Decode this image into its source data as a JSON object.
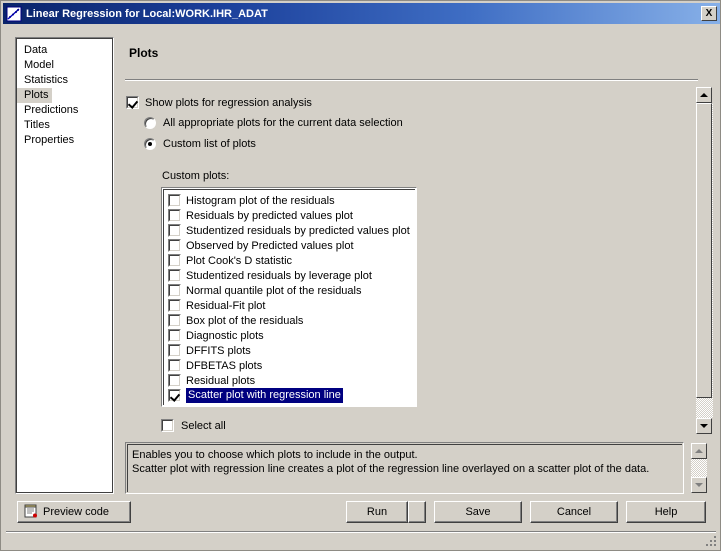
{
  "window": {
    "title": "Linear Regression for Local:WORK.IHR_ADAT",
    "title_icon": "regression-chart-icon",
    "close_label": "X"
  },
  "sidebar": {
    "items": [
      {
        "label": "Data",
        "selected": false
      },
      {
        "label": "Model",
        "selected": false
      },
      {
        "label": "Statistics",
        "selected": false
      },
      {
        "label": "Plots",
        "selected": true
      },
      {
        "label": "Predictions",
        "selected": false
      },
      {
        "label": "Titles",
        "selected": false
      },
      {
        "label": "Properties",
        "selected": false
      }
    ]
  },
  "main": {
    "page_title": "Plots",
    "show_plots": {
      "label": "Show plots for regression analysis",
      "checked": true
    },
    "plot_mode": {
      "options": [
        {
          "label": "All appropriate plots for the current data selection",
          "selected": false
        },
        {
          "label": "Custom list of plots",
          "selected": true
        }
      ]
    },
    "custom_plots_label": "Custom plots:",
    "custom_plots": [
      {
        "label": "Histogram plot of the residuals",
        "checked": false,
        "highlighted": false
      },
      {
        "label": "Residuals by predicted values plot",
        "checked": false,
        "highlighted": false
      },
      {
        "label": "Studentized residuals by predicted values plot",
        "checked": false,
        "highlighted": false
      },
      {
        "label": "Observed by Predicted values plot",
        "checked": false,
        "highlighted": false
      },
      {
        "label": "Plot Cook's D statistic",
        "checked": false,
        "highlighted": false
      },
      {
        "label": "Studentized residuals by leverage plot",
        "checked": false,
        "highlighted": false
      },
      {
        "label": "Normal quantile plot of the residuals",
        "checked": false,
        "highlighted": false
      },
      {
        "label": "Residual-Fit plot",
        "checked": false,
        "highlighted": false
      },
      {
        "label": "Box plot of the residuals",
        "checked": false,
        "highlighted": false
      },
      {
        "label": "Diagnostic plots",
        "checked": false,
        "highlighted": false
      },
      {
        "label": "DFFITS plots",
        "checked": false,
        "highlighted": false
      },
      {
        "label": "DFBETAS plots",
        "checked": false,
        "highlighted": false
      },
      {
        "label": "Residual plots",
        "checked": false,
        "highlighted": false
      },
      {
        "label": "Scatter plot with regression line",
        "checked": true,
        "highlighted": true
      }
    ],
    "select_all": {
      "label": "Select all",
      "checked": false
    },
    "description": [
      "Enables you to choose which plots to include in the output.",
      "Scatter plot with regression line creates a plot of the regression line overlayed on a scatter plot of the data."
    ]
  },
  "buttons": {
    "preview_code": "Preview code",
    "preview_code_icon": "notepad-icon",
    "run": "Run",
    "run_dropdown_icon": "chevron-down-icon",
    "save": "Save",
    "cancel": "Cancel",
    "help": "Help"
  },
  "colors": {
    "face": "#d4d0c8",
    "title_start": "#0a246a",
    "title_end": "#87b0e8",
    "selection": "#000080",
    "text": "#000000"
  }
}
